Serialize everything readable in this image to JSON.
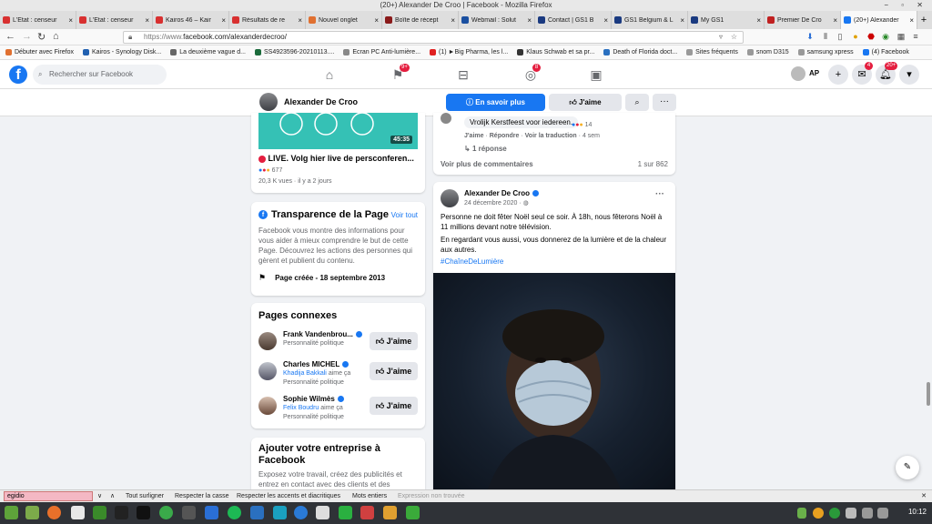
{
  "window": {
    "title": "(20+) Alexander De Croo | Facebook - Mozilla Firefox"
  },
  "tabs": [
    {
      "label": "L'État : censeur",
      "color": "#d83030"
    },
    {
      "label": "L'État : censeur",
      "color": "#d83030"
    },
    {
      "label": "Kairos 46 – Kair",
      "color": "#d83030"
    },
    {
      "label": "Résultats de re",
      "color": "#d83030"
    },
    {
      "label": "Nouvel onglet",
      "color": "#e07030"
    },
    {
      "label": "Boîte de récept",
      "color": "#8a1a1a"
    },
    {
      "label": "Webmail : Solut",
      "color": "#1a4fa0"
    },
    {
      "label": "Contact | GS1 B",
      "color": "#1a3a80"
    },
    {
      "label": "GS1 Belgium & L",
      "color": "#1a3a80"
    },
    {
      "label": "My GS1",
      "color": "#1a3a80"
    },
    {
      "label": "Premier De Cro",
      "color": "#c02020"
    },
    {
      "label": "(20+) Alexander",
      "color": "#1877f2"
    }
  ],
  "navbar": {
    "url_prefix": "https://www.",
    "url_main": "facebook.com/alexanderdecroo/"
  },
  "bookmarks": [
    {
      "label": "Débuter avec Firefox",
      "color": "#e07030"
    },
    {
      "label": "Kairos - Synology Disk...",
      "color": "#2060b0"
    },
    {
      "label": "La deuxième vague d...",
      "color": "#666"
    },
    {
      "label": "SS4923596-20210113....",
      "color": "#1a6a3a"
    },
    {
      "label": "Ecran PC Anti-lumière...",
      "color": "#888"
    },
    {
      "label": "(1) ►Big Pharma, les l...",
      "color": "#e02020"
    },
    {
      "label": "Klaus Schwab et sa pr...",
      "color": "#333"
    },
    {
      "label": "Death of Florida doct...",
      "color": "#2a70c0"
    },
    {
      "label": "Sites fréquents",
      "color": "#999"
    },
    {
      "label": "snom D315",
      "color": "#999"
    },
    {
      "label": "samsung xpress",
      "color": "#999"
    },
    {
      "label": "(4) Facebook",
      "color": "#1877f2"
    }
  ],
  "fb": {
    "search_placeholder": "Rechercher sur Facebook",
    "badge_flag": "9+",
    "badge_groups": "8",
    "me_initials": "AP",
    "badge_messenger": "4",
    "badge_notif": "20+"
  },
  "page_header": {
    "name": "Alexander De Croo",
    "more_button": "En savoir plus",
    "like_button": "J'aime"
  },
  "video_card": {
    "duration": "45:35",
    "title": "LIVE. Volg hier live de persconferen...",
    "reaction_count": "677",
    "meta": "20,3 K vues · il y a 2 jours"
  },
  "transparency": {
    "title": "Transparence de la Page",
    "see_all": "Voir tout",
    "description": "Facebook vous montre des informations pour vous aider à mieux comprendre le but de cette Page. Découvrez les actions des personnes qui gèrent et publient du contenu.",
    "created": "Page créée - 18 septembre 2013"
  },
  "related": {
    "title": "Pages connexes",
    "like_label": "J'aime",
    "items": [
      {
        "name": "Frank Vandenbrou...",
        "liker": "",
        "liker_suffix": "",
        "category": "Personnalité politique"
      },
      {
        "name": "Charles MICHEL",
        "liker": "Khadija Bakkali",
        "liker_suffix": " aime ça",
        "category": "Personnalité politique"
      },
      {
        "name": "Sophie Wilmès",
        "liker": "Felix Boudru",
        "liker_suffix": " aime ça",
        "category": "Personnalité politique"
      }
    ]
  },
  "business": {
    "title": "Ajouter votre entreprise à Facebook",
    "text": "Exposez votre travail, créez des publicités et entrez en contact avec des clients et des"
  },
  "comment": {
    "text": "Vrolijk Kerstfeest voor iedereen.",
    "reactions": "14",
    "like": "J'aime",
    "reply": "Répondre",
    "translate": "Voir la traduction",
    "time": "4 sem",
    "replies": "1 réponse",
    "more_comments": "Voir plus de commentaires",
    "count": "1 sur 862"
  },
  "post": {
    "author": "Alexander De Croo",
    "date": "24 décembre 2020",
    "para1": "Personne ne doit fêter Noël seul ce soir. À 18h, nous fêterons Noël à 11 millions devant notre télévision.",
    "para2": "En regardant vous aussi, vous donnerez de la lumière et de la chaleur aux autres.",
    "hashtag": "#ChaîneDeLumière"
  },
  "findbar": {
    "query": "egidio",
    "opt1": "Tout surligner",
    "opt2": "Respecter la casse",
    "opt3": "Respecter les accents et diacritiques",
    "opt4": "Mots entiers",
    "status": "Expression non trouvée"
  },
  "taskbar": {
    "clock": "10:12"
  }
}
